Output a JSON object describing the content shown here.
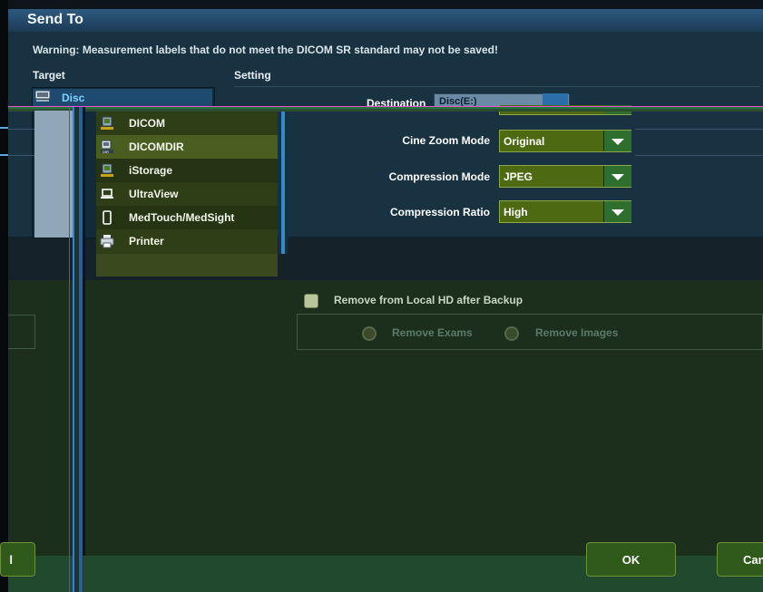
{
  "dialog": {
    "title": "Send To",
    "warning": "Warning: Measurement labels that do not meet the DICOM SR standard may not be saved!",
    "target_label": "Target",
    "setting_label": "Setting"
  },
  "targets": [
    {
      "label": "Disc",
      "icon": "disc-drive-icon"
    }
  ],
  "settings": {
    "destination_label": "Destination",
    "destination_value": "Disc(E:)",
    "cine_zoom_label": "Cine Zoom Mode",
    "cine_zoom_value": "Original",
    "compression_mode_label": "Compression Mode",
    "compression_mode_value": "JPEG",
    "compression_ratio_label": "Compression Ratio",
    "compression_ratio_value": "High"
  },
  "dropdown": {
    "items": [
      {
        "label": "DICOM",
        "icon": "dicom-icon"
      },
      {
        "label": "DICOMDIR",
        "icon": "dicomdir-icon",
        "selected": true
      },
      {
        "label": "iStorage",
        "icon": "storage-icon"
      },
      {
        "label": "UltraView",
        "icon": "laptop-icon"
      },
      {
        "label": "MedTouch/MedSight",
        "icon": "tablet-icon"
      },
      {
        "label": "Printer",
        "icon": "printer-icon"
      }
    ]
  },
  "backup": {
    "remove_label": "Remove from Local HD after Backup",
    "remove_exams": "Remove Exams",
    "remove_images": "Remove Images"
  },
  "buttons": {
    "ok": "OK",
    "cancel": "Can",
    "left": "l"
  },
  "colors": {
    "title_bar": "#2e5a80",
    "combo_bg": "#4d6a12",
    "selected_item": "#4a5e22",
    "button_bg": "#2f5a1c"
  }
}
